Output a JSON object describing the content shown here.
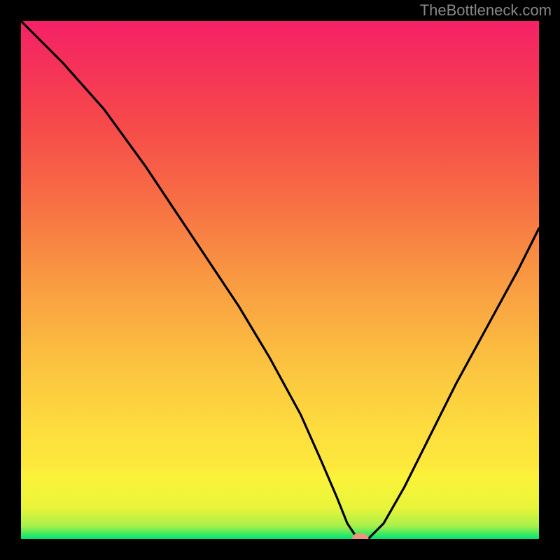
{
  "attribution": "TheBottleneck.com",
  "chart_data": {
    "type": "line",
    "title": "",
    "xlabel": "",
    "ylabel": "",
    "xlim": [
      0,
      100
    ],
    "ylim": [
      0,
      100
    ],
    "grid": false,
    "legend": false,
    "series": [
      {
        "name": "bottleneck-curve",
        "x": [
          0,
          8,
          16,
          24,
          30,
          36,
          42,
          48,
          54,
          58,
          61,
          63,
          65,
          67,
          70,
          74,
          78,
          84,
          90,
          96,
          100
        ],
        "values": [
          100,
          92,
          83,
          72,
          63,
          54,
          45,
          35,
          24,
          15,
          8,
          3,
          0,
          0,
          3,
          10,
          18,
          30,
          41,
          52,
          60
        ]
      }
    ],
    "marker": {
      "x": 65.5,
      "y": 0,
      "color": "#e9967a"
    },
    "background_gradient": {
      "stops": [
        {
          "pos": 0.0,
          "color": "#00e472"
        },
        {
          "pos": 0.012,
          "color": "#4eeb5e"
        },
        {
          "pos": 0.025,
          "color": "#a8f04a"
        },
        {
          "pos": 0.06,
          "color": "#e8f43a"
        },
        {
          "pos": 0.12,
          "color": "#fbf33a"
        },
        {
          "pos": 0.14,
          "color": "#fde93c"
        },
        {
          "pos": 0.2,
          "color": "#fddf3e"
        },
        {
          "pos": 0.35,
          "color": "#fbc040"
        },
        {
          "pos": 0.5,
          "color": "#f99a42"
        },
        {
          "pos": 0.65,
          "color": "#f76f44"
        },
        {
          "pos": 0.8,
          "color": "#f64a4a"
        },
        {
          "pos": 0.92,
          "color": "#f5305a"
        },
        {
          "pos": 1.0,
          "color": "#f52168"
        }
      ]
    }
  }
}
